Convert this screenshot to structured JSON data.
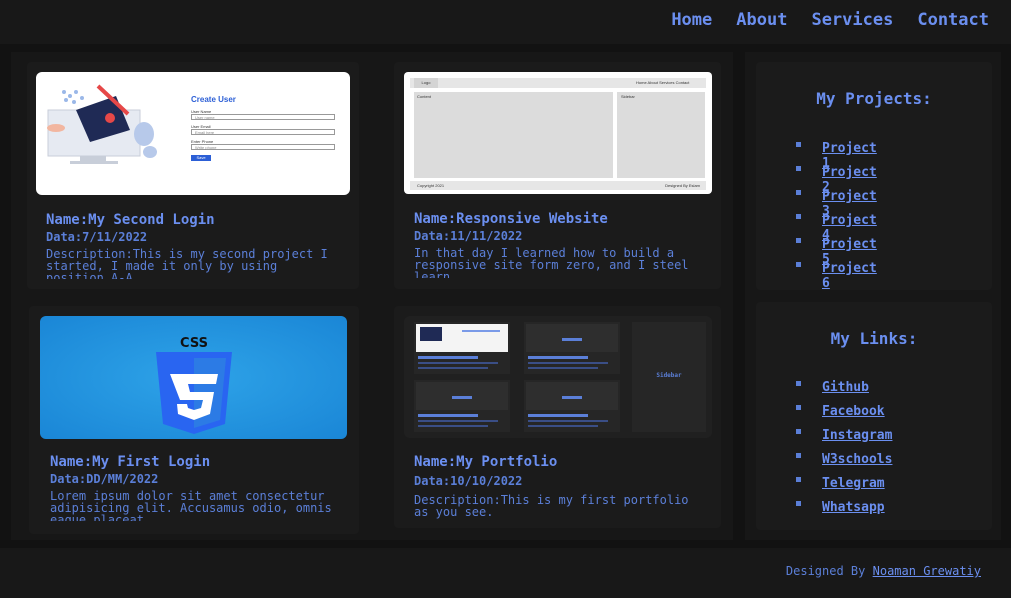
{
  "nav": {
    "home": "Home",
    "about": "About",
    "services": "Services",
    "contact": "Contact"
  },
  "cards": [
    {
      "name": "Name:My Second Login",
      "date": "Data:7/11/2022",
      "description": "Description:This is my second project I started, I made it only by using position A-A",
      "thumb": {
        "heading": "Create User",
        "field1": "User Name",
        "field1_ph": "User name",
        "field2": "User Email",
        "field2_ph": "Email here",
        "field3": "Enter Phone",
        "field3_ph": "Write phone",
        "button": "Save"
      }
    },
    {
      "name": "Name:Responsive Website",
      "date": "Data:11/11/2022",
      "description": "In that day I learned how to build a responsive site form zero, and I steel learn",
      "thumb": {
        "logo": "Logo",
        "menu": "Home About Services Contact",
        "content": "Content",
        "sidebar": "Sidebar",
        "copyright": "Copyright 2021",
        "designed": "Designed By Eslam"
      }
    },
    {
      "name": "Name:My First Login",
      "date": "Data:DD/MM/2022",
      "description": "Lorem ipsum dolor sit amet consectetur adipisicing elit. Accusamus odio, omnis eaque placeat",
      "thumb": {
        "logo_text": "CSS"
      }
    },
    {
      "name": "Name:My Portfolio",
      "date": "Data:10/10/2022",
      "description": "Description:This is my first portfolio as you see.",
      "thumb": {
        "sidebar": "Sidebar"
      }
    }
  ],
  "projects": {
    "title": "My Projects:",
    "items": [
      "Project 1",
      "Project 2",
      "Project 3",
      "Project 4",
      "Project 5",
      "Project 6"
    ]
  },
  "links": {
    "title": "My Links:",
    "items": [
      "Github",
      "Facebook",
      "Instagram",
      "W3schools",
      "Telegram",
      "Whatsapp"
    ]
  },
  "footer": {
    "prefix": "Designed By",
    "author": "Noaman Grewatiy"
  },
  "colors": {
    "accent": "#6b8ff0",
    "background": "#121212",
    "panel": "#1b1b1b"
  }
}
